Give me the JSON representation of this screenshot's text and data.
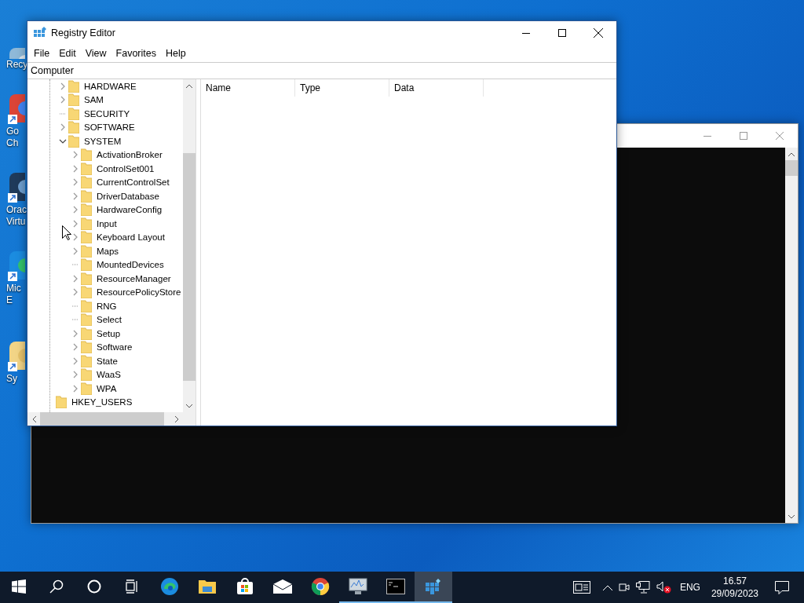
{
  "desktop_icons": [
    {
      "lines": [
        "Recy"
      ]
    },
    {
      "lines": [
        "Go",
        "Ch"
      ]
    },
    {
      "lines": [
        "Orac",
        "Virtu"
      ]
    },
    {
      "lines": [
        "Mic",
        "E"
      ]
    },
    {
      "lines": [
        "Sy"
      ]
    }
  ],
  "console_window": {
    "active": false
  },
  "registry_window": {
    "title": "Registry Editor",
    "menu": [
      "File",
      "Edit",
      "View",
      "Favorites",
      "Help"
    ],
    "address": "Computer",
    "tree": [
      {
        "label": "HARDWARE",
        "expandable": true
      },
      {
        "label": "SAM",
        "expandable": true
      },
      {
        "label": "SECURITY",
        "expandable": false
      },
      {
        "label": "SOFTWARE",
        "expandable": true
      },
      {
        "label": "SYSTEM",
        "expandable": true,
        "expanded": true,
        "children": [
          {
            "label": "ActivationBroker",
            "expandable": true
          },
          {
            "label": "ControlSet001",
            "expandable": true
          },
          {
            "label": "CurrentControlSet",
            "expandable": true
          },
          {
            "label": "DriverDatabase",
            "expandable": true
          },
          {
            "label": "HardwareConfig",
            "expandable": true
          },
          {
            "label": "Input",
            "expandable": true
          },
          {
            "label": "Keyboard Layout",
            "expandable": true
          },
          {
            "label": "Maps",
            "expandable": true
          },
          {
            "label": "MountedDevices",
            "expandable": false
          },
          {
            "label": "ResourceManager",
            "expandable": true
          },
          {
            "label": "ResourcePolicyStore",
            "expandable": true
          },
          {
            "label": "RNG",
            "expandable": false
          },
          {
            "label": "Select",
            "expandable": false
          },
          {
            "label": "Setup",
            "expandable": true
          },
          {
            "label": "Software",
            "expandable": true
          },
          {
            "label": "State",
            "expandable": true
          },
          {
            "label": "WaaS",
            "expandable": true
          },
          {
            "label": "WPA",
            "expandable": true
          }
        ]
      }
    ],
    "tree_after": {
      "label": "HKEY_USERS"
    },
    "columns": [
      "Name",
      "Type",
      "Data"
    ]
  },
  "taskbar": {
    "apps": [
      {
        "kind": "edge",
        "running": false,
        "selected": false
      },
      {
        "kind": "explorer",
        "running": false,
        "selected": false
      },
      {
        "kind": "store",
        "running": false,
        "selected": false
      },
      {
        "kind": "mail",
        "running": false,
        "selected": false
      },
      {
        "kind": "chrome",
        "running": false,
        "selected": false
      },
      {
        "kind": "monitor",
        "running": true,
        "selected": false
      },
      {
        "kind": "terminal",
        "running": true,
        "selected": false
      },
      {
        "kind": "regedit",
        "running": true,
        "selected": true
      }
    ],
    "language": "ENG",
    "time": "16.57",
    "date": "29/09/2023"
  }
}
